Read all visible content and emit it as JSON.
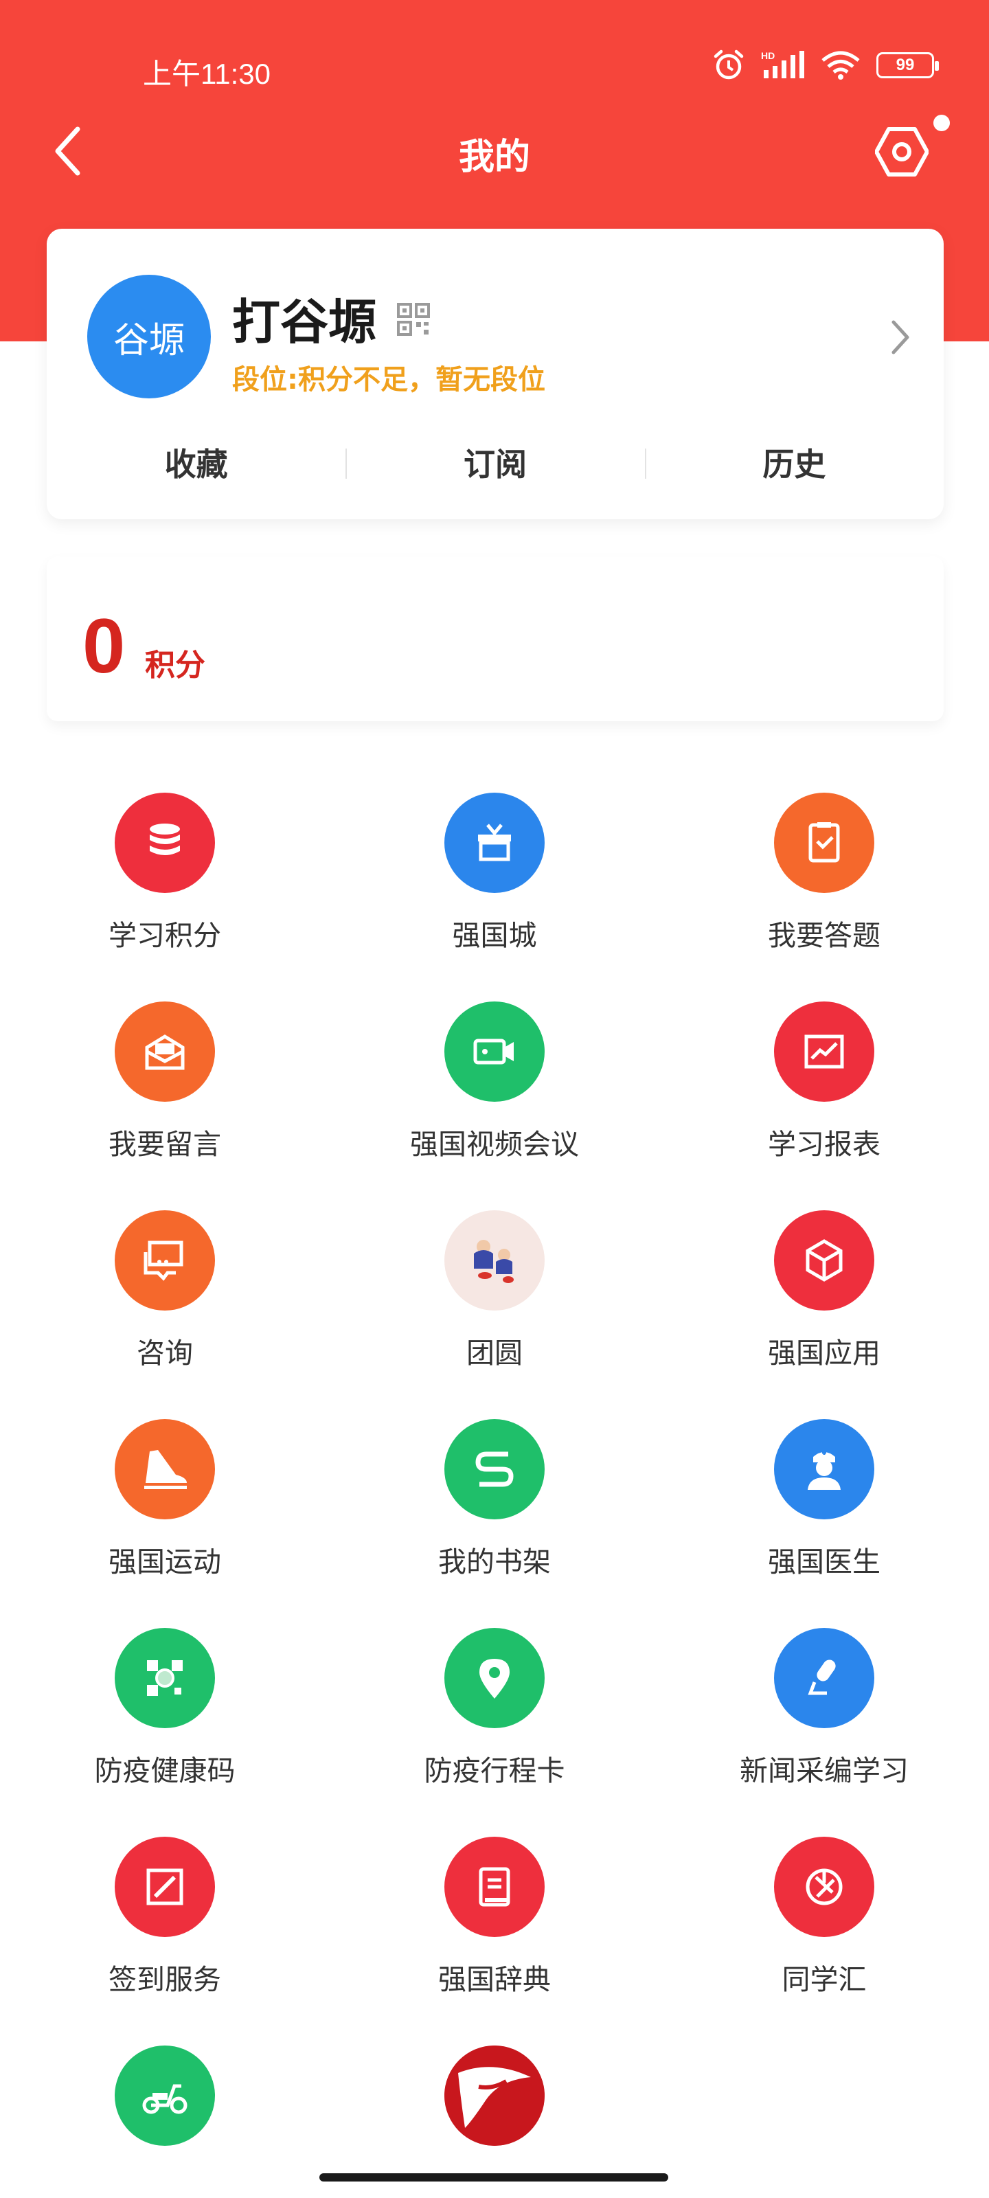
{
  "status_bar": {
    "time": "上午11:30",
    "battery": "99",
    "network": "HD"
  },
  "nav": {
    "title": "我的"
  },
  "profile": {
    "avatar_text": "谷塬",
    "name": "打谷塬",
    "rank": "段位:积分不足，暂无段位",
    "tabs": [
      "收藏",
      "订阅",
      "历史"
    ]
  },
  "score": {
    "value": "0",
    "unit": "积分"
  },
  "grid": [
    {
      "label": "学习积分",
      "icon": "database-icon",
      "color": "#ee2f3d"
    },
    {
      "label": "强国城",
      "icon": "gift-box-icon",
      "color": "#2b86ec"
    },
    {
      "label": "我要答题",
      "icon": "clipboard-check-icon",
      "color": "#f5682c"
    },
    {
      "label": "我要留言",
      "icon": "mail-icon",
      "color": "#f5682c"
    },
    {
      "label": "强国视频会议",
      "icon": "video-camera-icon",
      "color": "#1fbf6a"
    },
    {
      "label": "学习报表",
      "icon": "chart-trend-icon",
      "color": "#ee2f3d"
    },
    {
      "label": "咨询",
      "icon": "chat-icon",
      "color": "#f5682c"
    },
    {
      "label": "团圆",
      "icon": "reunion-illustration-icon",
      "color": "#f6e7e3"
    },
    {
      "label": "强国应用",
      "icon": "cube-icon",
      "color": "#ee2f3d"
    },
    {
      "label": "强国运动",
      "icon": "shoe-icon",
      "color": "#f5682c"
    },
    {
      "label": "我的书架",
      "icon": "bookshelf-icon",
      "color": "#1fbf6a"
    },
    {
      "label": "强国医生",
      "icon": "doctor-icon",
      "color": "#2b86ec"
    },
    {
      "label": "防疫健康码",
      "icon": "qr-scan-icon",
      "color": "#1fbf6a"
    },
    {
      "label": "防疫行程卡",
      "icon": "location-pin-icon",
      "color": "#1fbf6a"
    },
    {
      "label": "新闻采编学习",
      "icon": "microphone-icon",
      "color": "#2b86ec"
    },
    {
      "label": "签到服务",
      "icon": "sign-pen-icon",
      "color": "#ee2f3d"
    },
    {
      "label": "强国辞典",
      "icon": "dictionary-icon",
      "color": "#ee2f3d"
    },
    {
      "label": "同学汇",
      "icon": "aperture-icon",
      "color": "#ee2f3d"
    },
    {
      "label": "",
      "icon": "scooter-icon",
      "color": "#1fbf6a"
    },
    {
      "label": "",
      "icon": "brand-logo-icon",
      "color": "#c8171d"
    }
  ]
}
